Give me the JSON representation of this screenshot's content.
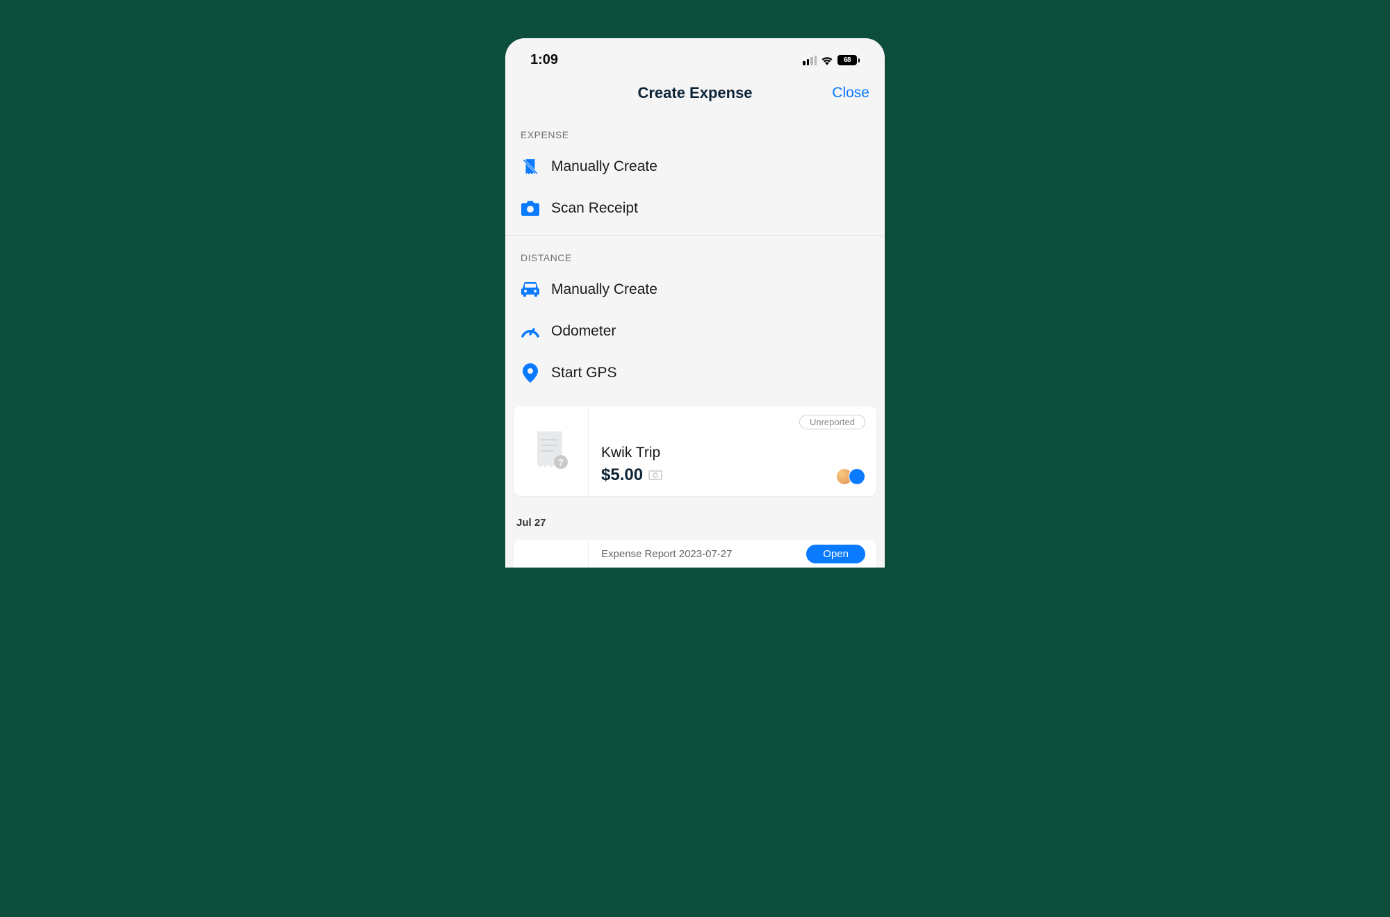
{
  "statusBar": {
    "time": "1:09",
    "battery": "68"
  },
  "header": {
    "title": "Create Expense",
    "close": "Close"
  },
  "sections": {
    "expense": {
      "label": "EXPENSE",
      "items": [
        {
          "label": "Manually Create",
          "icon": "receipt-manual"
        },
        {
          "label": "Scan Receipt",
          "icon": "camera"
        }
      ]
    },
    "distance": {
      "label": "DISTANCE",
      "items": [
        {
          "label": "Manually Create",
          "icon": "car"
        },
        {
          "label": "Odometer",
          "icon": "gauge"
        },
        {
          "label": "Start GPS",
          "icon": "pin"
        }
      ]
    }
  },
  "expenseCard": {
    "badge": "Unreported",
    "merchant": "Kwik Trip",
    "amount": "$5.00"
  },
  "dateHeader": "Jul 27",
  "report": {
    "name": "Expense Report 2023-07-27",
    "action": "Open"
  }
}
